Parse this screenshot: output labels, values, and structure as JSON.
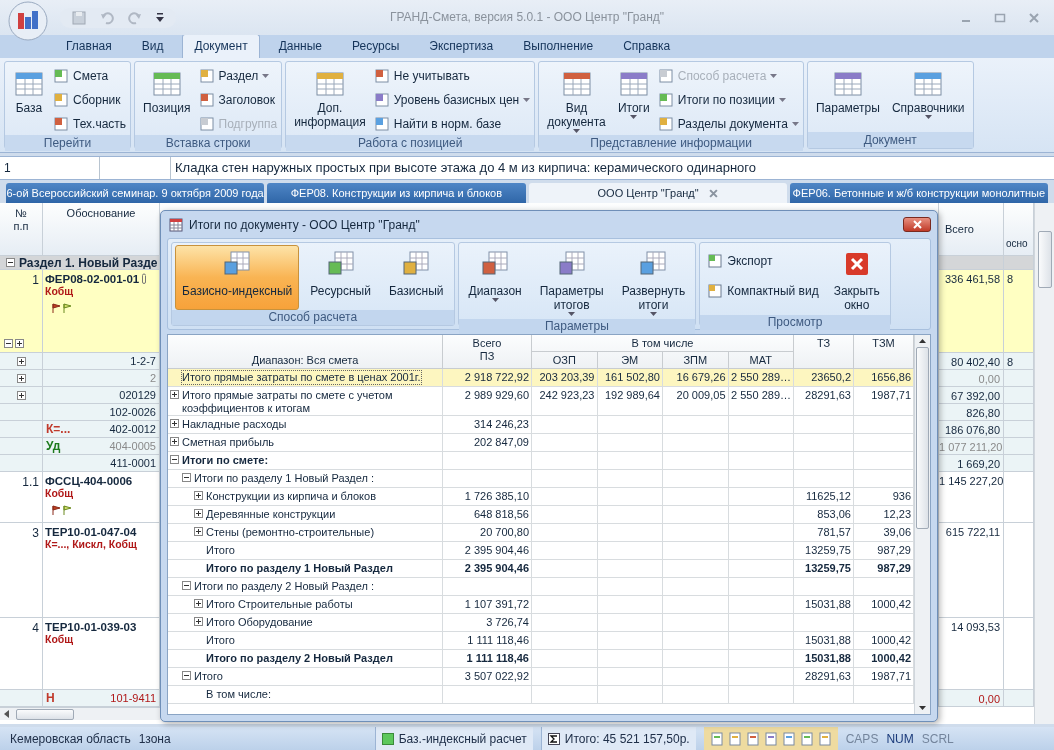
{
  "window": {
    "title": "ГРАНД-Смета, версия 5.0.1 - ООО Центр \"Гранд\""
  },
  "menu_tabs": [
    {
      "label": "Главная",
      "selected": false
    },
    {
      "label": "Вид",
      "selected": false
    },
    {
      "label": "Документ",
      "selected": true
    },
    {
      "label": "Данные",
      "selected": false
    },
    {
      "label": "Ресурсы",
      "selected": false
    },
    {
      "label": "Экспертиза",
      "selected": false
    },
    {
      "label": "Выполнение",
      "selected": false
    },
    {
      "label": "Справка",
      "selected": false
    }
  ],
  "ribbon": {
    "groups": [
      {
        "title": "Перейти",
        "items": [
          {
            "kind": "large",
            "label": "База",
            "dropdown": false,
            "disabled": false
          },
          {
            "kind": "small",
            "label": "Смета",
            "dropdown": false,
            "disabled": false
          },
          {
            "kind": "small",
            "label": "Сборник",
            "dropdown": false,
            "disabled": false
          },
          {
            "kind": "small",
            "label": "Тех.часть",
            "dropdown": false,
            "disabled": false
          }
        ]
      },
      {
        "title": "Вставка строки",
        "items": [
          {
            "kind": "large",
            "label": "Позиция",
            "dropdown": false,
            "disabled": false
          },
          {
            "kind": "small",
            "label": "Раздел",
            "dropdown": true,
            "disabled": false
          },
          {
            "kind": "small",
            "label": "Заголовок",
            "dropdown": false,
            "disabled": false
          },
          {
            "kind": "small",
            "label": "Подгруппа",
            "dropdown": false,
            "disabled": true
          }
        ]
      },
      {
        "title": "Работа с позицией",
        "items": [
          {
            "kind": "large",
            "label": "Доп.\nинформация",
            "dropdown": false,
            "disabled": false
          },
          {
            "kind": "small",
            "label": "Не учитывать",
            "dropdown": false,
            "disabled": false
          },
          {
            "kind": "small",
            "label": "Уровень базисных цен",
            "dropdown": true,
            "disabled": false
          },
          {
            "kind": "small",
            "label": "Найти в норм. базе",
            "dropdown": false,
            "disabled": false
          }
        ]
      },
      {
        "title": "Представление информации",
        "items": [
          {
            "kind": "large",
            "label": "Вид\nдокумента",
            "dropdown": true,
            "disabled": false
          },
          {
            "kind": "large",
            "label": "Итоги",
            "dropdown": true,
            "disabled": false
          },
          {
            "kind": "small",
            "label": "Способ расчета",
            "dropdown": true,
            "disabled": true
          },
          {
            "kind": "small",
            "label": "Итоги по позиции",
            "dropdown": true,
            "disabled": false
          },
          {
            "kind": "small",
            "label": "Разделы документа",
            "dropdown": true,
            "disabled": false
          }
        ]
      },
      {
        "title": "Документ",
        "items": [
          {
            "kind": "large",
            "label": "Параметры",
            "dropdown": false,
            "disabled": false
          },
          {
            "kind": "large",
            "label": "Справочники",
            "dropdown": true,
            "disabled": false
          }
        ]
      }
    ]
  },
  "formula_bar": {
    "cell": "1",
    "text": "Кладка стен наружных простых при высоте этажа до 4 м из кирпича: керамического одинарного"
  },
  "doc_tabs": [
    {
      "label": "6-ой Всероссийский семинар. 9 октября 2009 года",
      "selected": false,
      "closable": false
    },
    {
      "label": "ФЕР08. Конструкции из кирпича и блоков",
      "selected": false,
      "closable": false
    },
    {
      "label": "ООО Центр \"Гранд\"",
      "selected": true,
      "closable": true
    },
    {
      "label": "ФЕР06. Бетонные и ж/б конструкции монолитные",
      "selected": false,
      "closable": false
    }
  ],
  "sheet": {
    "columns": {
      "num": "№\nп.п",
      "basis": "Обоснование",
      "total": "Всего",
      "base": "осно"
    },
    "rows": [
      {
        "kind": "section",
        "label": "Раздел 1. Новый Разде"
      },
      {
        "kind": "position",
        "num": "1",
        "code": "ФЕР08-02-001-01",
        "note": "Кобщ",
        "selected": true,
        "attachment": true,
        "flags": true,
        "tree_controls": true,
        "total": "336 461,58",
        "base": "8"
      },
      {
        "kind": "resource",
        "expandable": true,
        "code": "1-2-7",
        "muted": false,
        "alert": false,
        "total": "80 402,40",
        "base": "8"
      },
      {
        "kind": "resource",
        "expandable": true,
        "code": "2",
        "muted": true,
        "alert": false,
        "total": "0,00"
      },
      {
        "kind": "resource",
        "expandable": true,
        "code": "020129",
        "muted": false,
        "alert": false,
        "total": "67 392,00"
      },
      {
        "kind": "resource",
        "expandable": false,
        "code": "102-0026",
        "muted": false,
        "alert": false,
        "total": "826,80"
      },
      {
        "kind": "resource",
        "expandable": false,
        "prefix": "К=...",
        "color": "#c0392b",
        "code": "402-0012",
        "muted": false,
        "alert": false,
        "total": "186 076,80"
      },
      {
        "kind": "resource",
        "expandable": false,
        "prefix": "Уд",
        "color": "#1e7a1e",
        "code": "404-0005",
        "muted": true,
        "alert": false,
        "total": "1 077 211,20"
      },
      {
        "kind": "resource",
        "expandable": false,
        "code": "411-0001",
        "muted": false,
        "alert": false,
        "total": "1 669,20"
      },
      {
        "kind": "position",
        "num": "1.1",
        "code": "ФССЦ-404-0006",
        "note": "Кобщ",
        "selected": false,
        "attachment": false,
        "flags": true,
        "tree_controls": false,
        "total": "1 145 227,20"
      },
      {
        "kind": "position",
        "num": "3",
        "code": "ТЕР10-01-047-04",
        "note": "К=..., Кискл, Кобщ",
        "selected": false,
        "attachment": false,
        "flags": false,
        "tree_controls": false,
        "total": "615 722,11"
      },
      {
        "kind": "position",
        "num": "4",
        "code": "ТЕР10-01-039-03",
        "note": "Кобщ",
        "selected": false,
        "attachment": false,
        "flags": false,
        "tree_controls": false,
        "total": "14 093,53"
      },
      {
        "kind": "resource",
        "expandable": false,
        "prefix": "Н",
        "color": "#c0392b",
        "code": "101-9411",
        "muted": false,
        "alert": true,
        "total": "0,00"
      }
    ]
  },
  "dialog": {
    "title": "Итоги по документу - ООО Центр \"Гранд\"",
    "groups": [
      {
        "title": "Способ расчета",
        "items": [
          {
            "label": "Базисно-индексный",
            "selected": true,
            "dropdown": false
          },
          {
            "label": "Ресурсный",
            "selected": false,
            "dropdown": false
          },
          {
            "label": "Базисный",
            "selected": false,
            "dropdown": false
          }
        ]
      },
      {
        "title": "Параметры",
        "items": [
          {
            "label": "Диапазон",
            "selected": false,
            "dropdown": true
          },
          {
            "label": "Параметры\nитогов",
            "selected": false,
            "dropdown": true
          },
          {
            "label": "Развернуть\nитоги",
            "selected": false,
            "dropdown": true
          }
        ]
      },
      {
        "title": "Просмотр",
        "items": [
          {
            "label": "Экспорт",
            "selected": false,
            "dropdown": false,
            "kind": "small"
          },
          {
            "label": "Компактный вид",
            "selected": false,
            "dropdown": false,
            "kind": "small"
          },
          {
            "label": "Закрыть\nокно",
            "selected": false,
            "dropdown": false,
            "kind": "large"
          }
        ]
      }
    ],
    "table": {
      "range": "Диапазон: Вся смета",
      "total_header": "Всего\nПЗ",
      "including": "В том числе",
      "columns": [
        "ОЗП",
        "ЭМ",
        "ЗПМ",
        "МАТ"
      ],
      "tz": "ТЗ",
      "tzm": "ТЗМ",
      "rows": [
        {
          "kind": "leaf",
          "label": "Итого прямые затраты по смете в ценах 2001г.",
          "bold": false,
          "selected": true,
          "values": {
            "pz": "2 918 722,92",
            "ozp": "203 203,39",
            "em": "161 502,80",
            "zpm": "16 679,26",
            "mat": "2 550 289…",
            "tz": "23650,2",
            "tzm": "1656,86"
          }
        },
        {
          "kind": "group",
          "label": "Итого прямые затраты по смете с учетом коэффициентов к итогам",
          "bold": false,
          "selected": false,
          "expanded": false,
          "values": {
            "pz": "2 989 929,60",
            "ozp": "242 923,23",
            "em": "192 989,64",
            "zpm": "20 009,05",
            "mat": "2 550 289…",
            "tz": "28291,63",
            "tzm": "1987,71"
          }
        },
        {
          "kind": "group",
          "label": "Накладные расходы",
          "bold": false,
          "selected": false,
          "expanded": false,
          "values": {
            "pz": "314 246,23"
          }
        },
        {
          "kind": "group",
          "label": "Сметная прибыль",
          "bold": false,
          "selected": false,
          "expanded": false,
          "values": {
            "pz": "202 847,09"
          }
        },
        {
          "kind": "group",
          "label": "Итоги по смете:",
          "bold": true,
          "selected": false,
          "expanded": true,
          "children": [
            {
              "kind": "group",
              "label": "Итоги по разделу 1 Новый Раздел :",
              "bold": false,
              "selected": false,
              "expanded": true,
              "children": [
                {
                  "kind": "group",
                  "label": "Конструкции из кирпича и блоков",
                  "bold": false,
                  "selected": false,
                  "expanded": false,
                  "values": {
                    "pz": "1 726 385,10",
                    "tz": "11625,12",
                    "tzm": "936"
                  }
                },
                {
                  "kind": "group",
                  "label": "Деревянные конструкции",
                  "bold": false,
                  "selected": false,
                  "expanded": false,
                  "values": {
                    "pz": "648 818,56",
                    "tz": "853,06",
                    "tzm": "12,23"
                  }
                },
                {
                  "kind": "group",
                  "label": "Стены (ремонтно-строительные)",
                  "bold": false,
                  "selected": false,
                  "expanded": false,
                  "values": {
                    "pz": "20 700,80",
                    "tz": "781,57",
                    "tzm": "39,06"
                  }
                },
                {
                  "kind": "leaf",
                  "label": "Итого",
                  "bold": false,
                  "selected": false,
                  "values": {
                    "pz": "2 395 904,46",
                    "tz": "13259,75",
                    "tzm": "987,29"
                  }
                },
                {
                  "kind": "leaf",
                  "label": "Итого по разделу 1 Новый Раздел",
                  "bold": true,
                  "selected": false,
                  "values": {
                    "pz": "2 395 904,46",
                    "tz": "13259,75",
                    "tzm": "987,29"
                  }
                }
              ]
            },
            {
              "kind": "group",
              "label": "Итоги по разделу 2 Новый Раздел :",
              "bold": false,
              "selected": false,
              "expanded": true,
              "children": [
                {
                  "kind": "group",
                  "label": "Итого Строительные работы",
                  "bold": false,
                  "selected": false,
                  "expanded": false,
                  "values": {
                    "pz": "1 107 391,72",
                    "tz": "15031,88",
                    "tzm": "1000,42"
                  }
                },
                {
                  "kind": "group",
                  "label": "Итого Оборудование",
                  "bold": false,
                  "selected": false,
                  "expanded": false,
                  "values": {
                    "pz": "3 726,74"
                  }
                },
                {
                  "kind": "leaf",
                  "label": "Итого",
                  "bold": false,
                  "selected": false,
                  "values": {
                    "pz": "1 111 118,46",
                    "tz": "15031,88",
                    "tzm": "1000,42"
                  }
                },
                {
                  "kind": "leaf",
                  "label": "Итого по разделу 2 Новый Раздел",
                  "bold": true,
                  "selected": false,
                  "values": {
                    "pz": "1 111 118,46",
                    "tz": "15031,88",
                    "tzm": "1000,42"
                  }
                }
              ]
            },
            {
              "kind": "group",
              "label": "Итого",
              "bold": false,
              "selected": false,
              "expanded": true,
              "values": {
                "pz": "3 507 022,92",
                "tz": "28291,63",
                "tzm": "1987,71"
              },
              "children": [
                {
                  "kind": "leaf",
                  "label": "В том числе:",
                  "bold": false,
                  "selected": false
                }
              ]
            }
          ]
        }
      ]
    }
  },
  "status_bar": {
    "region": "Кемеровская область",
    "zone": "1зона",
    "mode": "Баз.-индексный расчет",
    "total": "Итого: 45 521 157,50р.",
    "indicators": [
      {
        "label": "CAPS",
        "on": false
      },
      {
        "label": "NUM",
        "on": true
      },
      {
        "label": "SCRL",
        "on": false
      }
    ]
  }
}
